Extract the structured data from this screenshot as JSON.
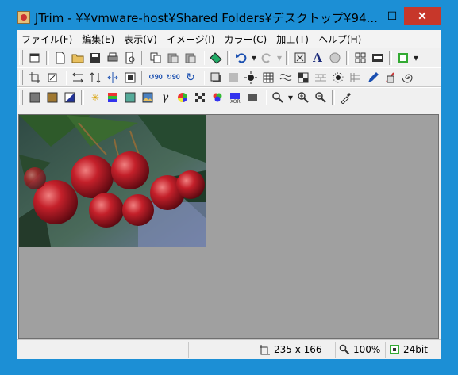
{
  "window": {
    "title": "JTrim - ¥¥vmware-host¥Shared Folders¥デスクトップ¥94...",
    "minimize": "—",
    "maximize": "☐",
    "close": "✕"
  },
  "menu": [
    "ファイル(F)",
    "編集(E)",
    "表示(V)",
    "イメージ(I)",
    "カラー(C)",
    "加工(T)",
    "ヘルプ(H)"
  ],
  "colors": {
    "titlebar": "#1c8fd5",
    "close_button": "#c7372a",
    "canvas_bg": "#a0a0a0"
  },
  "image": {
    "subject": "cherries photo"
  },
  "status": {
    "size": "235 x 166",
    "zoom": "100%",
    "depth": "24bit"
  }
}
